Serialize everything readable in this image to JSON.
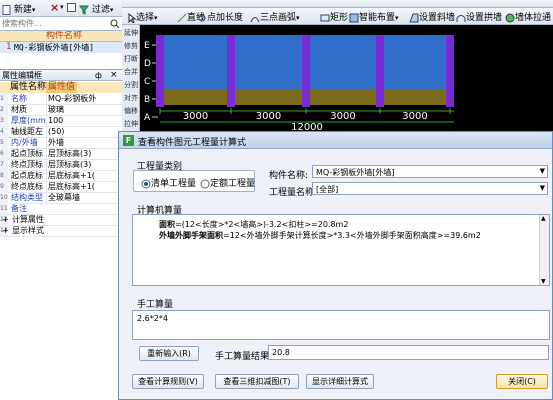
{
  "left_toolbar": {
    "new_label": "新建",
    "delete_icon": "×",
    "filter_label": "过滤"
  },
  "search": {
    "placeholder": "搜索构件..."
  },
  "component_list": {
    "header": "构件名称",
    "rows": [
      {
        "no": "1",
        "name": "MQ-彩钢板外墙[外墙]"
      }
    ]
  },
  "prop_panel": {
    "title": "属性编辑框",
    "pin": "ф",
    "close": "×",
    "col_name": "属性名称",
    "col_value": "属性值",
    "rows": [
      {
        "name": "名称",
        "value": "MQ-彩钢板外"
      },
      {
        "name": "材质",
        "value": "玻璃"
      },
      {
        "name": "厚度(mm",
        "value": "100"
      },
      {
        "name": "轴线距左",
        "value": "(50)"
      },
      {
        "name": "内/外墙",
        "value": "外墙"
      },
      {
        "name": "起点顶标",
        "value": "层顶标高(3)"
      },
      {
        "name": "终点顶标",
        "value": "层顶标高(3)"
      },
      {
        "name": "起点底标",
        "value": "层底标高+1("
      },
      {
        "name": "终点底标",
        "value": "层底标高+1("
      },
      {
        "name": "结构类型",
        "value": "全玻幕墙"
      },
      {
        "name": "备注",
        "value": ""
      },
      {
        "name": "计算属性",
        "value": ""
      },
      {
        "name": "显示样式",
        "value": ""
      }
    ],
    "num_col": [
      "1",
      "2",
      "3",
      "4",
      "5",
      "6",
      "7",
      "8",
      "9",
      "10",
      "11",
      "12",
      "13"
    ]
  },
  "top_toolbar": {
    "select": "选择",
    "line": "直线",
    "point_len": "点加长度",
    "arc": "三点画弧",
    "rect": "矩形",
    "smart": "智能布置",
    "slope": "设置斜墙",
    "arch": "设置拱墙",
    "wall_attr": "墙体拉通"
  },
  "side_tools": [
    "延伸",
    "修剪",
    "打断",
    "合并",
    "分割",
    "对齐",
    "偏移",
    "拉伸"
  ],
  "drawing": {
    "axes": [
      "E",
      "D",
      "C",
      "B",
      "A"
    ],
    "dims": [
      "3000",
      "3000",
      "3000",
      "3000"
    ],
    "total": "12000",
    "colors": {
      "bg": "#000000",
      "wall_blue": "#2f6fc9",
      "wall_olive": "#7a6a1a",
      "column": "#7b2bd6",
      "dim": "#ffffff"
    }
  },
  "dialog": {
    "title": "查看构件图元工程量计算式",
    "qty_type_label": "工程量类别",
    "radio1": "清单工程量",
    "radio2": "定额工程量",
    "comp_name_label": "构件名称:",
    "comp_name_value": "MQ-彩钢板外墙[外墙]",
    "qty_name_label": "工程量名称:",
    "qty_name_value": "[全部]",
    "calc_label": "计算机算量",
    "calc_line1_key": "面积",
    "calc_line1_rest": "=(12<长度>*2<墙高>)-3.2<扣柱>=20.8m2",
    "calc_line2_key": "外墙外脚手架面积",
    "calc_line2_rest": "=12<外墙外脚手架计算长度>*3.3<外墙外脚手架面积高度>=39.6m2",
    "manual_label": "手工算量",
    "manual_value": "2.6*2*4",
    "reinput": "重新输入(R)",
    "result_label": "手工算量结果=",
    "result_value": "20.8",
    "btn_rules": "查看计算规则(V)",
    "btn_3d": "查看三维扣减图(T)",
    "btn_detail": "显示详细计算式",
    "btn_close": "关闭(C)"
  }
}
